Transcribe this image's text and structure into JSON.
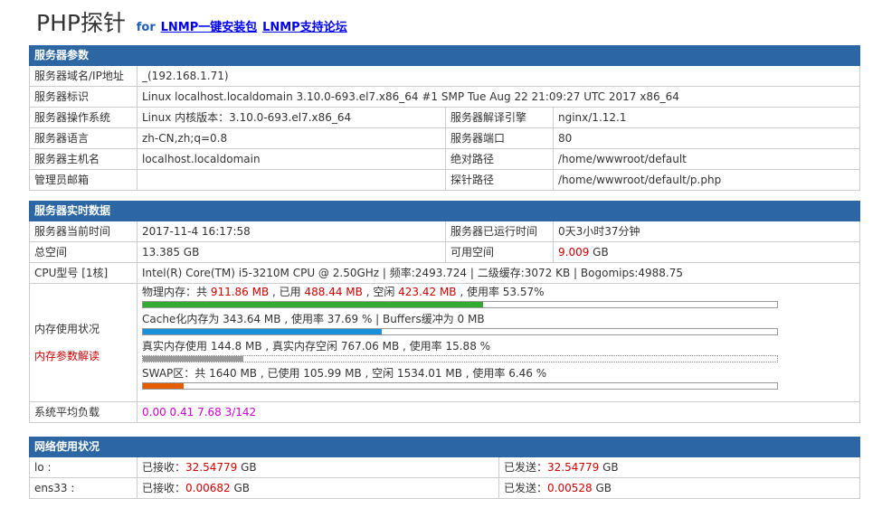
{
  "header": {
    "title": "PHP探针",
    "for_text": "for",
    "links": [
      "LNMP一键安装包",
      "LNMP支持论坛"
    ]
  },
  "server_params": {
    "section_title": "服务器参数",
    "domain_label": "服务器域名/IP地址",
    "domain_value": "_(192.168.1.71)",
    "id_label": "服务器标识",
    "id_value": "Linux localhost.localdomain 3.10.0-693.el7.x86_64 #1 SMP Tue Aug 22 21:09:27 UTC 2017 x86_64",
    "os_label": "服务器操作系统",
    "os_value": "Linux  内核版本：3.10.0-693.el7.x86_64",
    "engine_label": "服务器解译引擎",
    "engine_value": "nginx/1.12.1",
    "lang_label": "服务器语言",
    "lang_value": "zh-CN,zh;q=0.8",
    "port_label": "服务器端口",
    "port_value": "80",
    "host_label": "服务器主机名",
    "host_value": "localhost.localdomain",
    "abspath_label": "绝对路径",
    "abspath_value": "/home/wwwroot/default",
    "admin_label": "管理员邮箱",
    "admin_value": "",
    "probepath_label": "探针路径",
    "probepath_value": "/home/wwwroot/default/p.php"
  },
  "realtime": {
    "section_title": "服务器实时数据",
    "time_label": "服务器当前时间",
    "time_value": "2017-11-4 16:17:58",
    "uptime_label": "服务器已运行时间",
    "uptime_value": "0天3小时37分钟",
    "total_space_label": "总空间",
    "total_space_value": "13.385 GB",
    "free_space_label": "可用空间",
    "free_space_number": "9.009",
    "free_space_unit": " GB",
    "cpu_label": "CPU型号 [1核]",
    "cpu_value": "Intel(R) Core(TM) i5-3210M CPU @ 2.50GHz | 频率:2493.724 | 二级缓存:3072 KB | Bogomips:4988.75",
    "mem_label": "内存使用状况",
    "mem_help": "内存参数解读",
    "physical": {
      "prefix": "物理内存：共 ",
      "total": "911.86 MB",
      "mid1": " , 已用 ",
      "used": "488.44 MB",
      "mid2": " , 空闲 ",
      "free": "423.42 MB",
      "suffix": " , 使用率 53.57%",
      "percent": 53.57,
      "color": "#33aa33"
    },
    "cache": {
      "text": "Cache化内存为 343.64 MB , 使用率 37.69 % | Buffers缓冲为 0 MB",
      "percent": 37.69,
      "color": "#1a8fdc"
    },
    "real": {
      "text": "真实内存使用 144.8 MB , 真实内存空闲 767.06 MB , 使用率 15.88 %",
      "percent": 15.88,
      "color": "#999999"
    },
    "swap": {
      "text": "SWAP区：共 1640 MB , 已使用 105.99 MB , 空闲 1534.01 MB , 使用率 6.46 %",
      "percent": 6.46,
      "color": "#e65c00"
    },
    "load_label": "系统平均负载",
    "load_value": "0.00 0.41 7.68 3/142"
  },
  "network": {
    "section_title": "网络使用状况",
    "rows": [
      {
        "iface": "lo :",
        "rx_label": "已接收：",
        "rx": "32.54779",
        "rx_unit": " GB",
        "tx_label": "已发送：",
        "tx": "32.54779",
        "tx_unit": " GB"
      },
      {
        "iface": "ens33 :",
        "rx_label": "已接收：",
        "rx": "0.00682",
        "rx_unit": " GB",
        "tx_label": "已发送：",
        "tx": "0.00528",
        "tx_unit": " GB"
      }
    ]
  }
}
